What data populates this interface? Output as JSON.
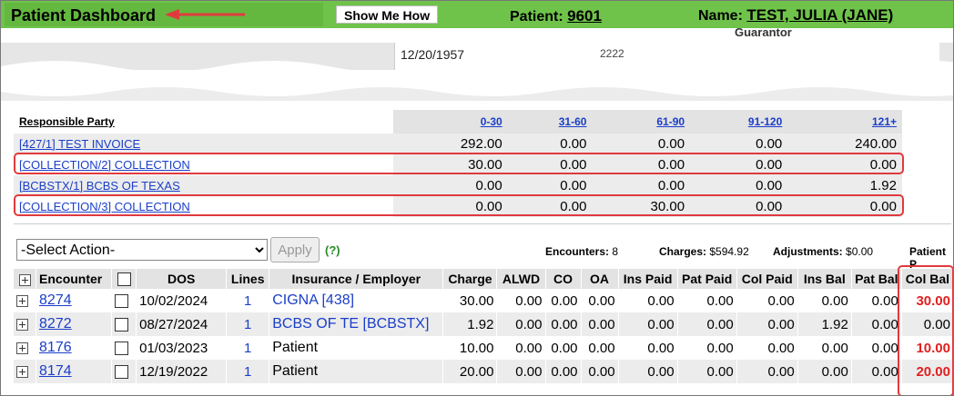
{
  "header": {
    "title": "Patient Dashboard",
    "show_me_how": "Show Me How",
    "patient_label": "Patient:",
    "patient_id": "9601",
    "name_label": "Name:",
    "patient_name": "TEST, JULIA (JANE)",
    "guarantor_label": "Guarantor"
  },
  "info": {
    "dob": "12/20/1957",
    "phone_partial": "2222"
  },
  "aging": {
    "header": [
      "Responsible Party",
      "0-30",
      "31-60",
      "61-90",
      "91-120",
      "121+"
    ],
    "rows": [
      {
        "party": "[427/1] TEST INVOICE",
        "vals": [
          "292.00",
          "0.00",
          "0.00",
          "0.00",
          "240.00"
        ]
      },
      {
        "party": "[COLLECTION/2] COLLECTION",
        "vals": [
          "30.00",
          "0.00",
          "0.00",
          "0.00",
          "0.00"
        ]
      },
      {
        "party": "[BCBSTX/1] BCBS OF TEXAS",
        "vals": [
          "0.00",
          "0.00",
          "0.00",
          "0.00",
          "1.92"
        ]
      },
      {
        "party": "[COLLECTION/3] COLLECTION",
        "vals": [
          "0.00",
          "0.00",
          "30.00",
          "0.00",
          "0.00"
        ]
      }
    ]
  },
  "actions": {
    "select_placeholder": "-Select Action-",
    "apply": "Apply",
    "help": "(?)",
    "encounters_label": "Encounters:",
    "encounters": "8",
    "charges_label": "Charges:",
    "charges": "$594.92",
    "adjustments_label": "Adjustments:",
    "adjustments": "$0.00",
    "patient_label": "Patient P"
  },
  "encounters": {
    "columns": [
      "Encounter",
      "DOS",
      "Lines",
      "Insurance / Employer",
      "Charge",
      "ALWD",
      "CO",
      "OA",
      "Ins Paid",
      "Pat Paid",
      "Col Paid",
      "Ins Bal",
      "Pat Bal",
      "Col Bal"
    ],
    "rows": [
      {
        "enc": "8274",
        "dos": "10/02/2024",
        "lines": "1",
        "ins": "CIGNA [438]",
        "charge": "30.00",
        "alwd": "0.00",
        "co": "0.00",
        "oa": "0.00",
        "ins_paid": "0.00",
        "pat_paid": "0.00",
        "col_paid": "0.00",
        "ins_bal": "0.00",
        "pat_bal": "0.00",
        "col_bal": "30.00"
      },
      {
        "enc": "8272",
        "dos": "08/27/2024",
        "lines": "1",
        "ins": "BCBS OF TE [BCBSTX]",
        "charge": "1.92",
        "alwd": "0.00",
        "co": "0.00",
        "oa": "0.00",
        "ins_paid": "0.00",
        "pat_paid": "0.00",
        "col_paid": "0.00",
        "ins_bal": "1.92",
        "pat_bal": "0.00",
        "col_bal": "0.00"
      },
      {
        "enc": "8176",
        "dos": "01/03/2023",
        "lines": "1",
        "ins": "Patient",
        "charge": "10.00",
        "alwd": "0.00",
        "co": "0.00",
        "oa": "0.00",
        "ins_paid": "0.00",
        "pat_paid": "0.00",
        "col_paid": "0.00",
        "ins_bal": "0.00",
        "pat_bal": "0.00",
        "col_bal": "10.00"
      },
      {
        "enc": "8174",
        "dos": "12/19/2022",
        "lines": "1",
        "ins": "Patient",
        "charge": "20.00",
        "alwd": "0.00",
        "co": "0.00",
        "oa": "0.00",
        "ins_paid": "0.00",
        "pat_paid": "0.00",
        "col_paid": "0.00",
        "ins_bal": "0.00",
        "pat_bal": "0.00",
        "col_bal": "20.00"
      }
    ]
  },
  "colors": {
    "header_green": "#6fc34a",
    "link_blue": "#1a3ec9",
    "highlight_red": "#e03a3e"
  }
}
